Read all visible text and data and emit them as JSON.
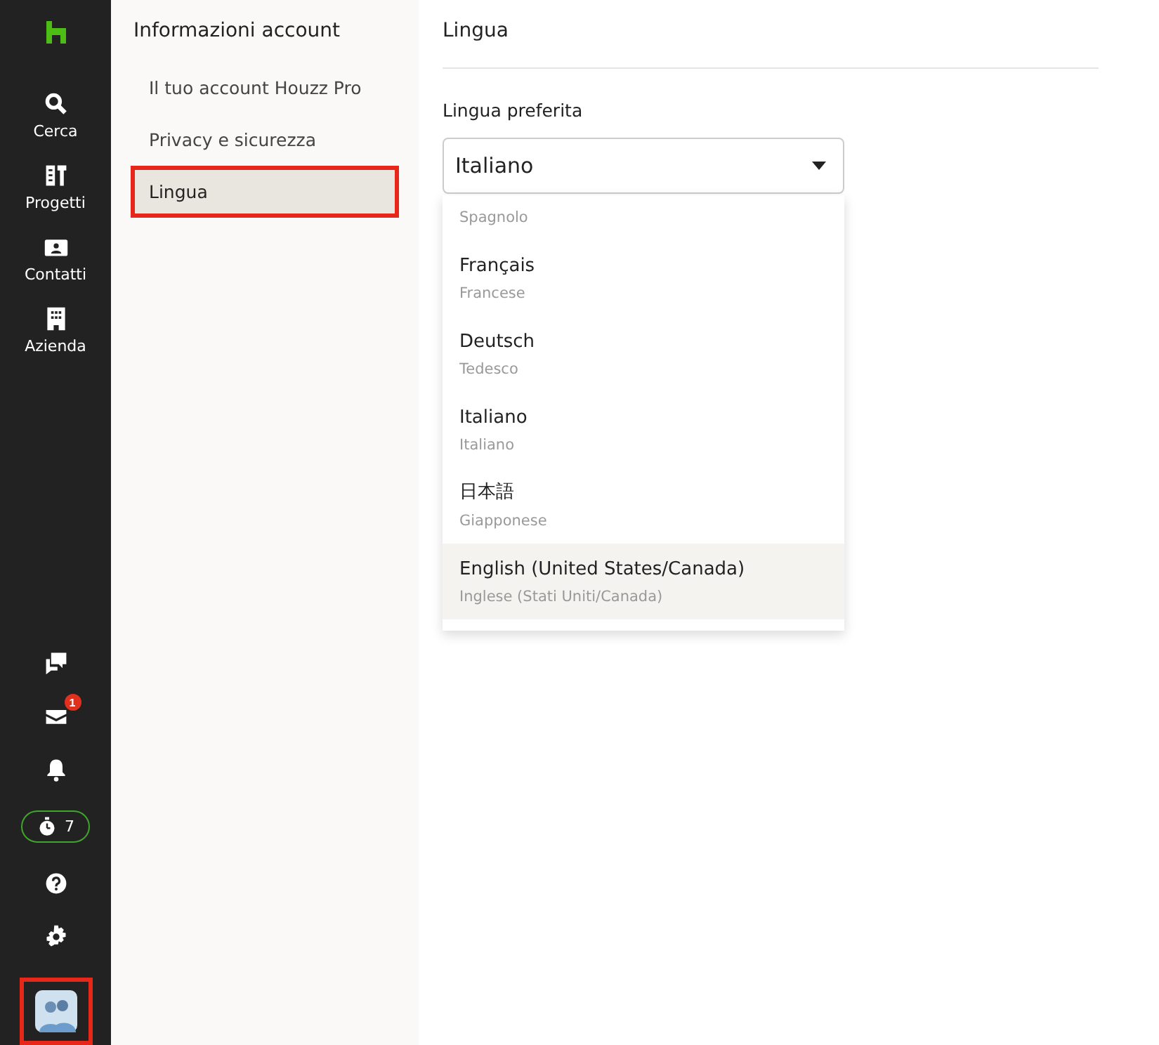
{
  "nav": {
    "top": [
      {
        "kind": "search",
        "label": "Cerca"
      },
      {
        "kind": "projects",
        "label": "Progetti"
      },
      {
        "kind": "contacts",
        "label": "Contatti"
      },
      {
        "kind": "company",
        "label": "Azienda"
      }
    ],
    "bottom": [
      {
        "kind": "chat"
      },
      {
        "kind": "mail",
        "badge": "1"
      },
      {
        "kind": "bell"
      },
      {
        "kind": "timer",
        "count": "7"
      },
      {
        "kind": "help"
      },
      {
        "kind": "settings"
      },
      {
        "kind": "avatar",
        "annotated": true
      }
    ]
  },
  "sidebar": {
    "title": "Informazioni account",
    "items": [
      {
        "label": "Il tuo account Houzz Pro",
        "selected": false,
        "annotated": false
      },
      {
        "label": "Privacy e sicurezza",
        "selected": false,
        "annotated": false
      },
      {
        "label": "Lingua",
        "selected": true,
        "annotated": true
      }
    ]
  },
  "main": {
    "title": "Lingua",
    "field_label": "Lingua preferita",
    "select": {
      "value": "Italiano",
      "expanded": true
    },
    "options": [
      {
        "translation": "Spagnolo",
        "highlighted": false
      },
      {
        "name": "Français",
        "translation": "Francese",
        "highlighted": false
      },
      {
        "name": "Deutsch",
        "translation": "Tedesco",
        "highlighted": false
      },
      {
        "name": "Italiano",
        "translation": "Italiano",
        "highlighted": false
      },
      {
        "name": "日本語",
        "translation": "Giapponese",
        "highlighted": false
      },
      {
        "name": "English (United States/Canada)",
        "translation": "Inglese (Stati Uniti/Canada)",
        "highlighted": true
      }
    ]
  }
}
